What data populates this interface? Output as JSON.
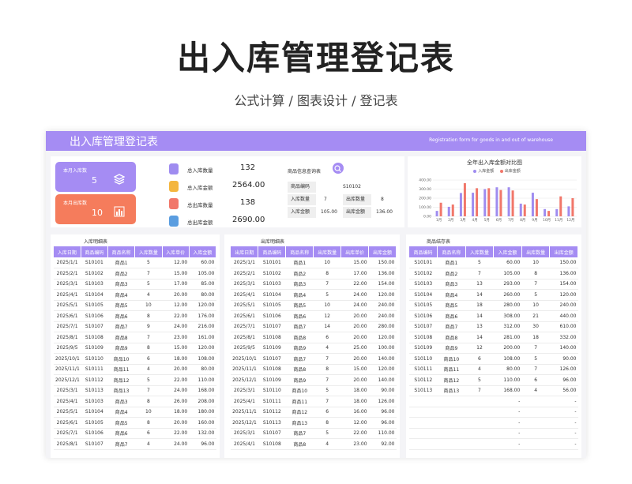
{
  "hero": {
    "title": "出入库管理登记表",
    "subtitle": "公式计算 / 图表设计 / 登记表"
  },
  "banner": {
    "title": "出入库管理登记表",
    "subtitle_en": "Registration form for goods in and out of warehouse"
  },
  "colors": {
    "accent": "#a58cf3",
    "inbound_card": "#a58cf3",
    "outbound_card": "#f57c5c",
    "series_in": "#9f8cf0",
    "series_out": "#f1776a"
  },
  "cards": [
    {
      "label": "本月入库数",
      "value": "5"
    },
    {
      "label": "本月出库数",
      "value": "10"
    }
  ],
  "stats": [
    {
      "label": "总入库数量",
      "value": "132",
      "icon": "clipboard-icon",
      "color": "#9f8cf0"
    },
    {
      "label": "总入库金额",
      "value": "2564.00",
      "icon": "coin-stack-icon",
      "color": "#f4b63f"
    },
    {
      "label": "总出库数量",
      "value": "138",
      "icon": "trash-icon",
      "color": "#f1776a"
    },
    {
      "label": "总出库金额",
      "value": "2690.00",
      "icon": "database-icon",
      "color": "#5a9de0"
    }
  ],
  "query": {
    "title": "商品信息查询表",
    "code_label": "商品编码",
    "code_value": "S10102",
    "in_qty_label": "入库数量",
    "in_qty_value": "7",
    "out_qty_label": "出库数量",
    "out_qty_value": "8",
    "in_amt_label": "入库金额",
    "in_amt_value": "105.00",
    "out_amt_label": "出库金额",
    "out_amt_value": "136.00"
  },
  "chart_data": {
    "type": "bar",
    "title": "全年出入库金额对比图",
    "categories": [
      "1月",
      "2月",
      "3月",
      "4月",
      "5月",
      "6月",
      "7月",
      "8月",
      "9月",
      "10月",
      "11月",
      "12月"
    ],
    "series": [
      {
        "name": "入库金额",
        "values": [
          60,
          105,
          257,
          260,
          300,
          320,
          320,
          140,
          260,
          80,
          80,
          110
        ]
      },
      {
        "name": "出库金额",
        "values": [
          150,
          130,
          365,
          310,
          310,
          290,
          285,
          130,
          190,
          60,
          220,
          200
        ]
      }
    ],
    "yticks": [
      "0.00",
      "100.00",
      "200.00",
      "300.00",
      "400.00"
    ],
    "ylim": [
      0,
      400
    ],
    "grid": true,
    "legend": "top"
  },
  "inbound": {
    "title": "入库明细表",
    "headers": [
      "入库日期",
      "商品编码",
      "商品名称",
      "入库数量",
      "入库单价",
      "入库金额"
    ],
    "rows": [
      [
        "2025/1/1",
        "S10101",
        "商品1",
        "5",
        "12.00",
        "60.00"
      ],
      [
        "2025/2/1",
        "S10102",
        "商品2",
        "7",
        "15.00",
        "105.00"
      ],
      [
        "2025/3/1",
        "S10103",
        "商品3",
        "5",
        "17.00",
        "85.00"
      ],
      [
        "2025/4/1",
        "S10104",
        "商品4",
        "4",
        "20.00",
        "80.00"
      ],
      [
        "2025/5/1",
        "S10105",
        "商品5",
        "10",
        "12.00",
        "120.00"
      ],
      [
        "2025/6/1",
        "S10106",
        "商品6",
        "8",
        "22.00",
        "176.00"
      ],
      [
        "2025/7/1",
        "S10107",
        "商品7",
        "9",
        "24.00",
        "216.00"
      ],
      [
        "2025/8/1",
        "S10108",
        "商品8",
        "7",
        "23.00",
        "161.00"
      ],
      [
        "2025/9/5",
        "S10109",
        "商品9",
        "8",
        "15.00",
        "120.00"
      ],
      [
        "2025/10/1",
        "S10110",
        "商品10",
        "6",
        "18.00",
        "108.00"
      ],
      [
        "2025/11/1",
        "S10111",
        "商品11",
        "4",
        "20.00",
        "80.00"
      ],
      [
        "2025/12/1",
        "S10112",
        "商品12",
        "5",
        "22.00",
        "110.00"
      ],
      [
        "2025/3/1",
        "S10113",
        "商品13",
        "7",
        "24.00",
        "168.00"
      ],
      [
        "2025/4/1",
        "S10103",
        "商品3",
        "8",
        "26.00",
        "208.00"
      ],
      [
        "2025/5/1",
        "S10104",
        "商品4",
        "10",
        "18.00",
        "180.00"
      ],
      [
        "2025/6/1",
        "S10105",
        "商品5",
        "8",
        "20.00",
        "160.00"
      ],
      [
        "2025/7/1",
        "S10106",
        "商品6",
        "6",
        "22.00",
        "132.00"
      ],
      [
        "2025/8/1",
        "S10107",
        "商品7",
        "4",
        "24.00",
        "96.00"
      ]
    ]
  },
  "outbound": {
    "title": "出库明细表",
    "headers": [
      "出库日期",
      "商品编码",
      "商品名称",
      "出库数量",
      "出库单价",
      "出库金额"
    ],
    "rows": [
      [
        "2025/1/1",
        "S10101",
        "商品1",
        "10",
        "15.00",
        "150.00"
      ],
      [
        "2025/2/1",
        "S10102",
        "商品2",
        "8",
        "17.00",
        "136.00"
      ],
      [
        "2025/3/1",
        "S10103",
        "商品3",
        "7",
        "22.00",
        "154.00"
      ],
      [
        "2025/4/1",
        "S10104",
        "商品4",
        "5",
        "24.00",
        "120.00"
      ],
      [
        "2025/5/1",
        "S10105",
        "商品5",
        "10",
        "24.00",
        "240.00"
      ],
      [
        "2025/6/1",
        "S10106",
        "商品6",
        "12",
        "20.00",
        "240.00"
      ],
      [
        "2025/7/1",
        "S10107",
        "商品7",
        "14",
        "20.00",
        "280.00"
      ],
      [
        "2025/8/1",
        "S10108",
        "商品8",
        "6",
        "20.00",
        "120.00"
      ],
      [
        "2025/9/5",
        "S10109",
        "商品9",
        "4",
        "25.00",
        "100.00"
      ],
      [
        "2025/10/1",
        "S10107",
        "商品7",
        "7",
        "20.00",
        "140.00"
      ],
      [
        "2025/11/1",
        "S10108",
        "商品8",
        "8",
        "15.00",
        "120.00"
      ],
      [
        "2025/12/1",
        "S10109",
        "商品9",
        "7",
        "20.00",
        "140.00"
      ],
      [
        "2025/3/1",
        "S10110",
        "商品10",
        "5",
        "18.00",
        "90.00"
      ],
      [
        "2025/4/1",
        "S10111",
        "商品11",
        "7",
        "18.00",
        "126.00"
      ],
      [
        "2025/11/1",
        "S10112",
        "商品12",
        "6",
        "16.00",
        "96.00"
      ],
      [
        "2025/12/1",
        "S10113",
        "商品13",
        "8",
        "12.00",
        "96.00"
      ],
      [
        "2025/3/1",
        "S10107",
        "商品7",
        "5",
        "22.00",
        "110.00"
      ],
      [
        "2025/4/1",
        "S10108",
        "商品8",
        "4",
        "23.00",
        "92.00"
      ]
    ]
  },
  "inventory": {
    "title": "商品结存表",
    "headers": [
      "商品编码",
      "商品名称",
      "入库数量",
      "入库金额",
      "出库数量",
      "出库金额"
    ],
    "rows": [
      [
        "S10101",
        "商品1",
        "5",
        "60.00",
        "10",
        "150.00"
      ],
      [
        "S10102",
        "商品2",
        "7",
        "105.00",
        "8",
        "136.00"
      ],
      [
        "S10103",
        "商品3",
        "13",
        "293.00",
        "7",
        "154.00"
      ],
      [
        "S10104",
        "商品4",
        "14",
        "260.00",
        "5",
        "120.00"
      ],
      [
        "S10105",
        "商品5",
        "18",
        "280.00",
        "10",
        "240.00"
      ],
      [
        "S10106",
        "商品6",
        "14",
        "308.00",
        "21",
        "440.00"
      ],
      [
        "S10107",
        "商品7",
        "13",
        "312.00",
        "30",
        "610.00"
      ],
      [
        "S10108",
        "商品8",
        "14",
        "281.00",
        "18",
        "332.00"
      ],
      [
        "S10109",
        "商品9",
        "12",
        "200.00",
        "7",
        "140.00"
      ],
      [
        "S10110",
        "商品10",
        "6",
        "108.00",
        "5",
        "90.00"
      ],
      [
        "S10111",
        "商品11",
        "4",
        "80.00",
        "7",
        "126.00"
      ],
      [
        "S10112",
        "商品12",
        "5",
        "110.00",
        "6",
        "96.00"
      ],
      [
        "S10113",
        "商品13",
        "7",
        "168.00",
        "4",
        "56.00"
      ],
      [
        "",
        "",
        "",
        "-",
        "",
        "-"
      ],
      [
        "",
        "",
        "",
        "-",
        "",
        "-"
      ],
      [
        "",
        "",
        "",
        "-",
        "",
        "-"
      ],
      [
        "",
        "",
        "",
        "-",
        "",
        "-"
      ],
      [
        "",
        "",
        "",
        "-",
        "",
        "-"
      ]
    ]
  }
}
